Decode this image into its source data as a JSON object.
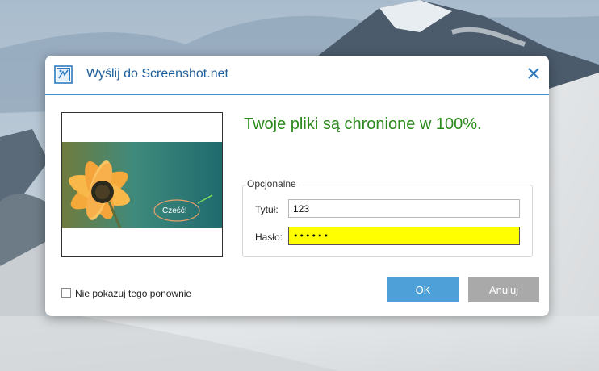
{
  "dialog": {
    "title": "Wyślij do Screenshot.net",
    "secure_message": "Twoje pliki są chronione w 100%.",
    "preview_bubble_text": "Cześć!",
    "optional_group_label": "Opcjonalne",
    "title_label": "Tytuł:",
    "title_value": "123",
    "password_label": "Hasło:",
    "password_value": "123456",
    "dont_show_label": "Nie pokazuj tego ponownie",
    "dont_show_checked": false,
    "ok_label": "OK",
    "cancel_label": "Anuluj"
  },
  "icons": {
    "app": "screenshot-app-icon",
    "close": "close-icon"
  },
  "colors": {
    "accent": "#1f5f9b",
    "secure_text": "#2b8a1b",
    "ok_button": "#4ea0d8",
    "cancel_button": "#a9a9a9",
    "password_highlight": "#ffff00"
  }
}
